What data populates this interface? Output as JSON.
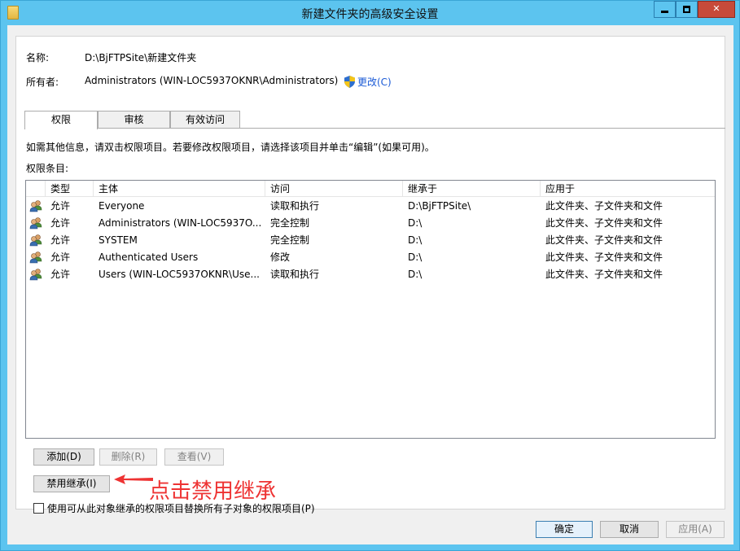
{
  "window": {
    "title": "新建文件夹的高级安全设置"
  },
  "info": {
    "name_label": "名称:",
    "name_value": "D:\\BjFTPSite\\新建文件夹",
    "owner_label": "所有者:",
    "owner_value": "Administrators (WIN-LOC5937OKNR\\Administrators)",
    "change_link": "更改(C)"
  },
  "tabs": [
    {
      "label": "权限"
    },
    {
      "label": "审核"
    },
    {
      "label": "有效访问"
    }
  ],
  "help_text": "如需其他信息，请双击权限项目。若要修改权限项目，请选择该项目并单击“编辑”(如果可用)。",
  "entries_label": "权限条目:",
  "table": {
    "columns": [
      "类型",
      "主体",
      "访问",
      "继承于",
      "应用于"
    ],
    "rows": [
      {
        "type": "允许",
        "principal": "Everyone",
        "access": "读取和执行",
        "inherited": "D:\\BjFTPSite\\",
        "applies": "此文件夹、子文件夹和文件"
      },
      {
        "type": "允许",
        "principal": "Administrators (WIN-LOC5937O...",
        "access": "完全控制",
        "inherited": "D:\\",
        "applies": "此文件夹、子文件夹和文件"
      },
      {
        "type": "允许",
        "principal": "SYSTEM",
        "access": "完全控制",
        "inherited": "D:\\",
        "applies": "此文件夹、子文件夹和文件"
      },
      {
        "type": "允许",
        "principal": "Authenticated Users",
        "access": "修改",
        "inherited": "D:\\",
        "applies": "此文件夹、子文件夹和文件"
      },
      {
        "type": "允许",
        "principal": "Users (WIN-LOC5937OKNR\\Use...",
        "access": "读取和执行",
        "inherited": "D:\\",
        "applies": "此文件夹、子文件夹和文件"
      }
    ]
  },
  "buttons": {
    "add": "添加(D)",
    "remove": "删除(R)",
    "view": "查看(V)",
    "disable_inheritance": "禁用继承(I)",
    "ok": "确定",
    "cancel": "取消",
    "apply": "应用(A)"
  },
  "replace_checkbox_label": "使用可从此对象继承的权限项目替换所有子对象的权限项目(P)",
  "annotation": "点击禁用继承",
  "colors": {
    "titlebar": "#5cc4ef",
    "link": "#1a5ad6",
    "annotation": "#ee3333"
  }
}
